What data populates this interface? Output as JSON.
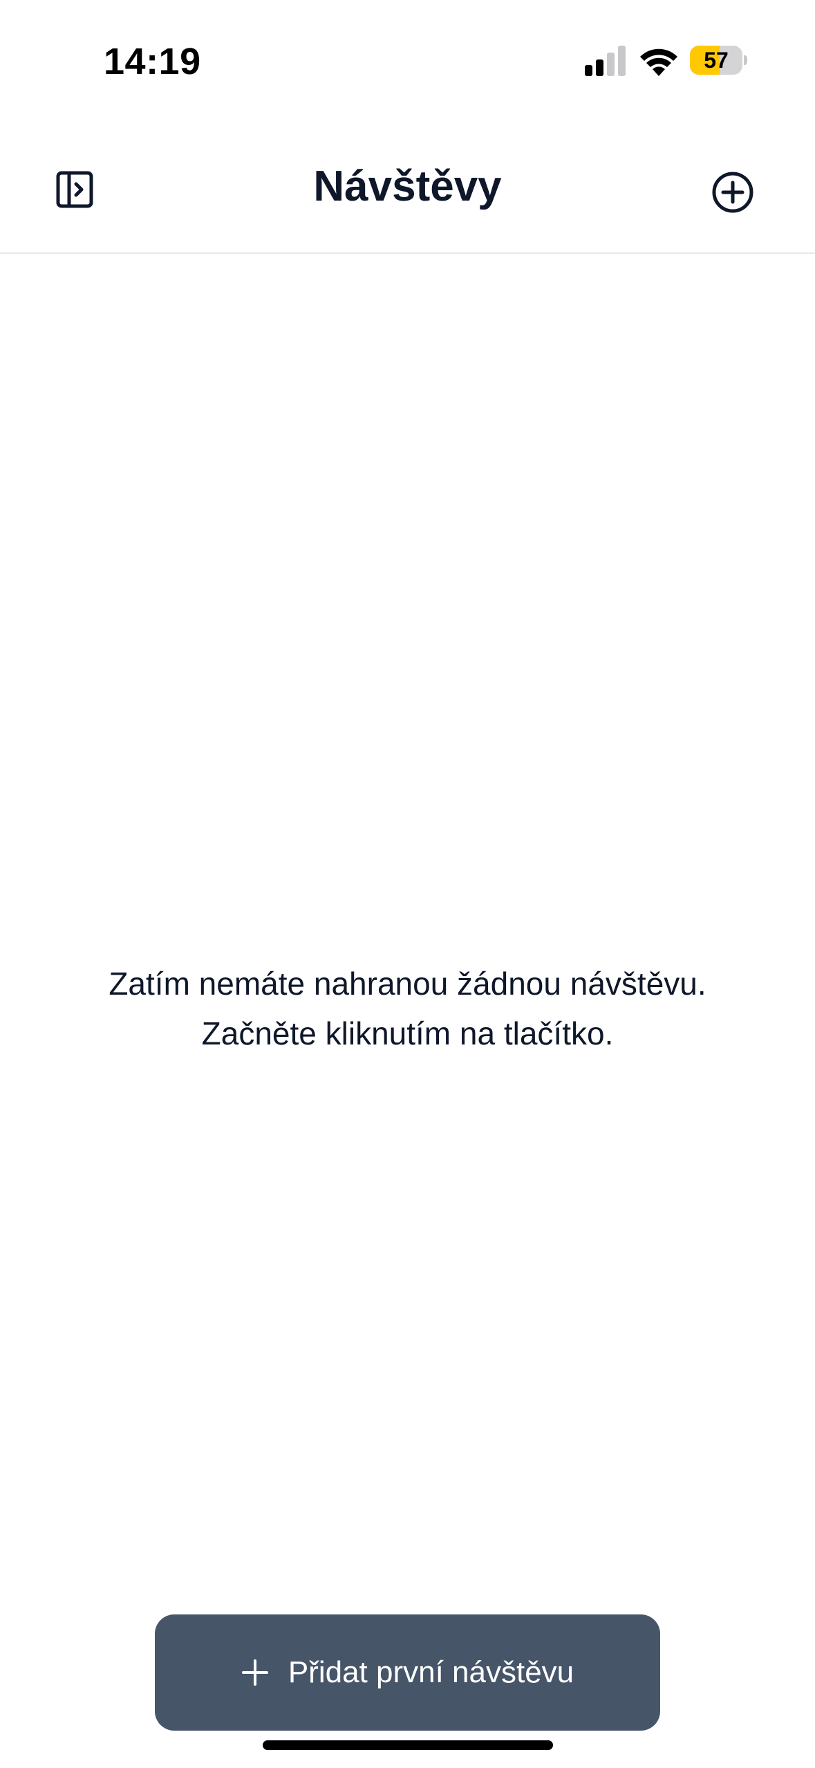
{
  "status_bar": {
    "time": "14:19",
    "battery_level": "57",
    "battery_fraction": 0.57,
    "battery_color": "#ffc800",
    "signal_icon": "cellular-signal-icon",
    "wifi_icon": "wifi-icon"
  },
  "nav": {
    "title": "Návštěvy",
    "left_icon": "sidebar-toggle-icon",
    "right_icon": "plus-circle-icon"
  },
  "empty_state": {
    "line1": "Zatím nemáte nahranou žádnou návštěvu.",
    "line2": "Začněte kliknutím na tlačítko."
  },
  "primary_button": {
    "label": "Přidat první návštěvu",
    "icon": "plus-icon",
    "background": "#475569"
  }
}
